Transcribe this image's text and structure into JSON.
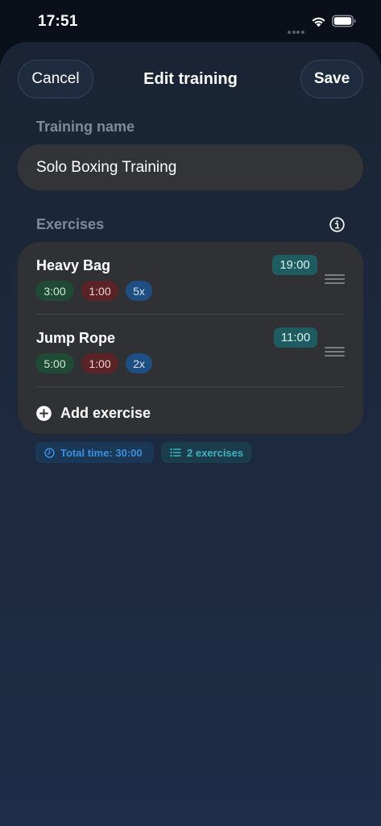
{
  "status_bar": {
    "time": "17:51"
  },
  "nav": {
    "cancel_label": "Cancel",
    "title": "Edit training",
    "save_label": "Save"
  },
  "form": {
    "name_label": "Training name",
    "name_value": "Solo Boxing Training",
    "exercises_label": "Exercises"
  },
  "exercises": [
    {
      "name": "Heavy Bag",
      "total": "19:00",
      "work": "3:00",
      "rest": "1:00",
      "reps": "5x"
    },
    {
      "name": "Jump Rope",
      "total": "11:00",
      "work": "5:00",
      "rest": "1:00",
      "reps": "2x"
    }
  ],
  "add_exercise_label": "Add exercise",
  "summary": {
    "total_time": "Total time: 30:00",
    "exercise_count": "2 exercises"
  },
  "colors": {
    "work_chip": "#1f4a36",
    "rest_chip": "#5b2326",
    "reps_chip": "#1f4f82",
    "total_badge": "#1f5c62",
    "accent_blue": "#3d8fe0",
    "accent_teal": "#3fb3c4"
  },
  "icons": {
    "info": "info-circle-icon",
    "drag": "drag-handle-icon",
    "add": "plus-circle-icon",
    "clock": "clock-icon",
    "list": "list-icon",
    "wifi": "wifi-icon",
    "battery": "battery-icon"
  }
}
